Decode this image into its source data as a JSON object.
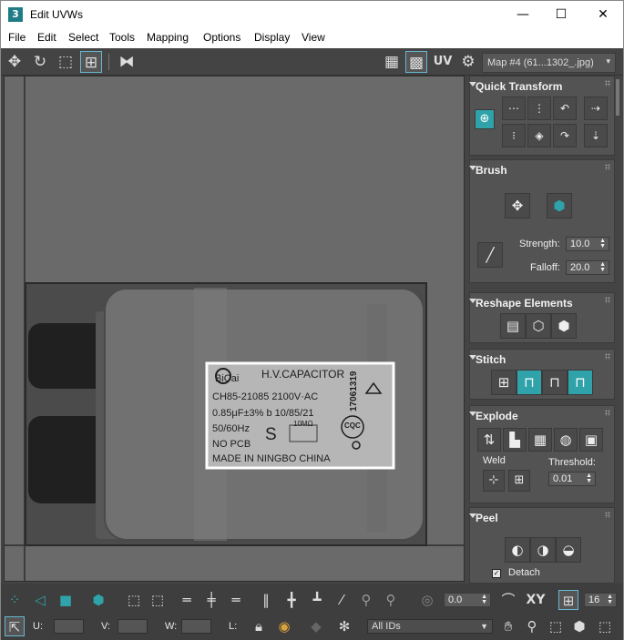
{
  "window": {
    "app_icon_label": "3",
    "title": "Edit UVWs",
    "minimize": "—",
    "maximize": "☐",
    "close": "✕"
  },
  "menu": [
    "File",
    "Edit",
    "Select",
    "Tools",
    "Mapping",
    "Options",
    "Display",
    "View"
  ],
  "toolbar": {
    "uv_label": "UV",
    "map_select": "Map #4 (61...1302_.jpg)",
    "map_arrow": "▾"
  },
  "capacitor_label": {
    "brand": "BiCai",
    "heading": "H.V.CAPACITOR",
    "line1": "CH85-21085 2100V·AC",
    "line2": "0.85μF±3% b 10/85/21",
    "line3": "50/60Hz",
    "line4": "NO PCB",
    "letter_s": "S",
    "resistor": "10MΩ",
    "mark": "CQC",
    "date_code": "17061319",
    "line5": "MADE IN NINGBO CHINA"
  },
  "panel": {
    "quick_transform": {
      "title": "Quick Transform"
    },
    "brush": {
      "title": "Brush",
      "strength_label": "Strength:",
      "strength_value": "10.0",
      "falloff_label": "Falloff:",
      "falloff_value": "20.0"
    },
    "reshape": {
      "title": "Reshape Elements"
    },
    "stitch": {
      "title": "Stitch"
    },
    "explode": {
      "title": "Explode",
      "weld_label": "Weld",
      "threshold_label": "Threshold:",
      "threshold_value": "0.01"
    },
    "peel": {
      "title": "Peel",
      "detach_label": "Detach"
    }
  },
  "bottom": {
    "spin_value": "0.0",
    "xy_label": "XY",
    "grid_value": "16",
    "u_label": "U:",
    "v_label": "V:",
    "w_label": "W:",
    "l_label": "L:",
    "ids_select": "All IDs"
  },
  "colors": {
    "accent": "#2fa3a9",
    "background": "#444444",
    "viewport": "#6a6a6a"
  }
}
